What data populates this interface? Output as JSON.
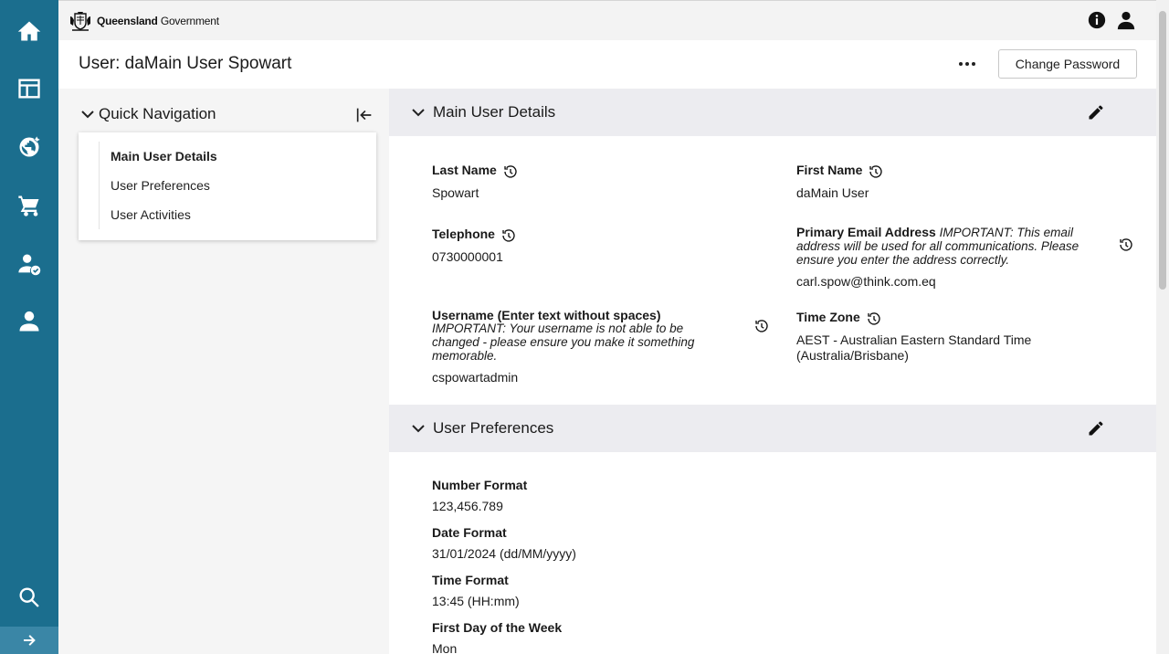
{
  "header": {
    "logo_bold": "Queensland",
    "logo_regular": "Government"
  },
  "rail": {
    "items": [
      "home-icon",
      "dashboard-icon",
      "globe-icon",
      "cart-icon",
      "user-check-icon",
      "user-icon"
    ],
    "bottom": "search-icon",
    "expand": "arrow-right-icon"
  },
  "page": {
    "title": "User: daMain User Spowart",
    "change_password_label": "Change Password"
  },
  "quick_nav": {
    "title": "Quick Navigation",
    "items": [
      {
        "label": "Main User Details",
        "active": true
      },
      {
        "label": "User Preferences",
        "active": false
      },
      {
        "label": "User Activities",
        "active": false
      }
    ]
  },
  "main_details": {
    "title": "Main User Details",
    "last_name_label": "Last Name",
    "last_name_value": "Spowart",
    "first_name_label": "First Name",
    "first_name_value": "daMain User",
    "telephone_label": "Telephone",
    "telephone_value": "0730000001",
    "email_label": "Primary Email Address",
    "email_note": "IMPORTANT: This email address will be used for all communications. Please ensure you enter the address correctly.",
    "email_value": "carl.spow@think.com.eq",
    "username_label": "Username (Enter text without spaces)",
    "username_note": "IMPORTANT: Your username is not able to be changed - please ensure you make it something memorable.",
    "username_value": "cspowartadmin",
    "timezone_label": "Time Zone",
    "timezone_value": "AEST - Australian Eastern Standard Time (Australia/Brisbane)"
  },
  "preferences": {
    "title": "User Preferences",
    "number_format_label": "Number Format",
    "number_format_value": "123,456.789",
    "date_format_label": "Date Format",
    "date_format_value": "31/01/2024 (dd/MM/yyyy)",
    "time_format_label": "Time Format",
    "time_format_value": "13:45 (HH:mm)",
    "first_day_label": "First Day of the Week",
    "first_day_value": "Mon"
  }
}
